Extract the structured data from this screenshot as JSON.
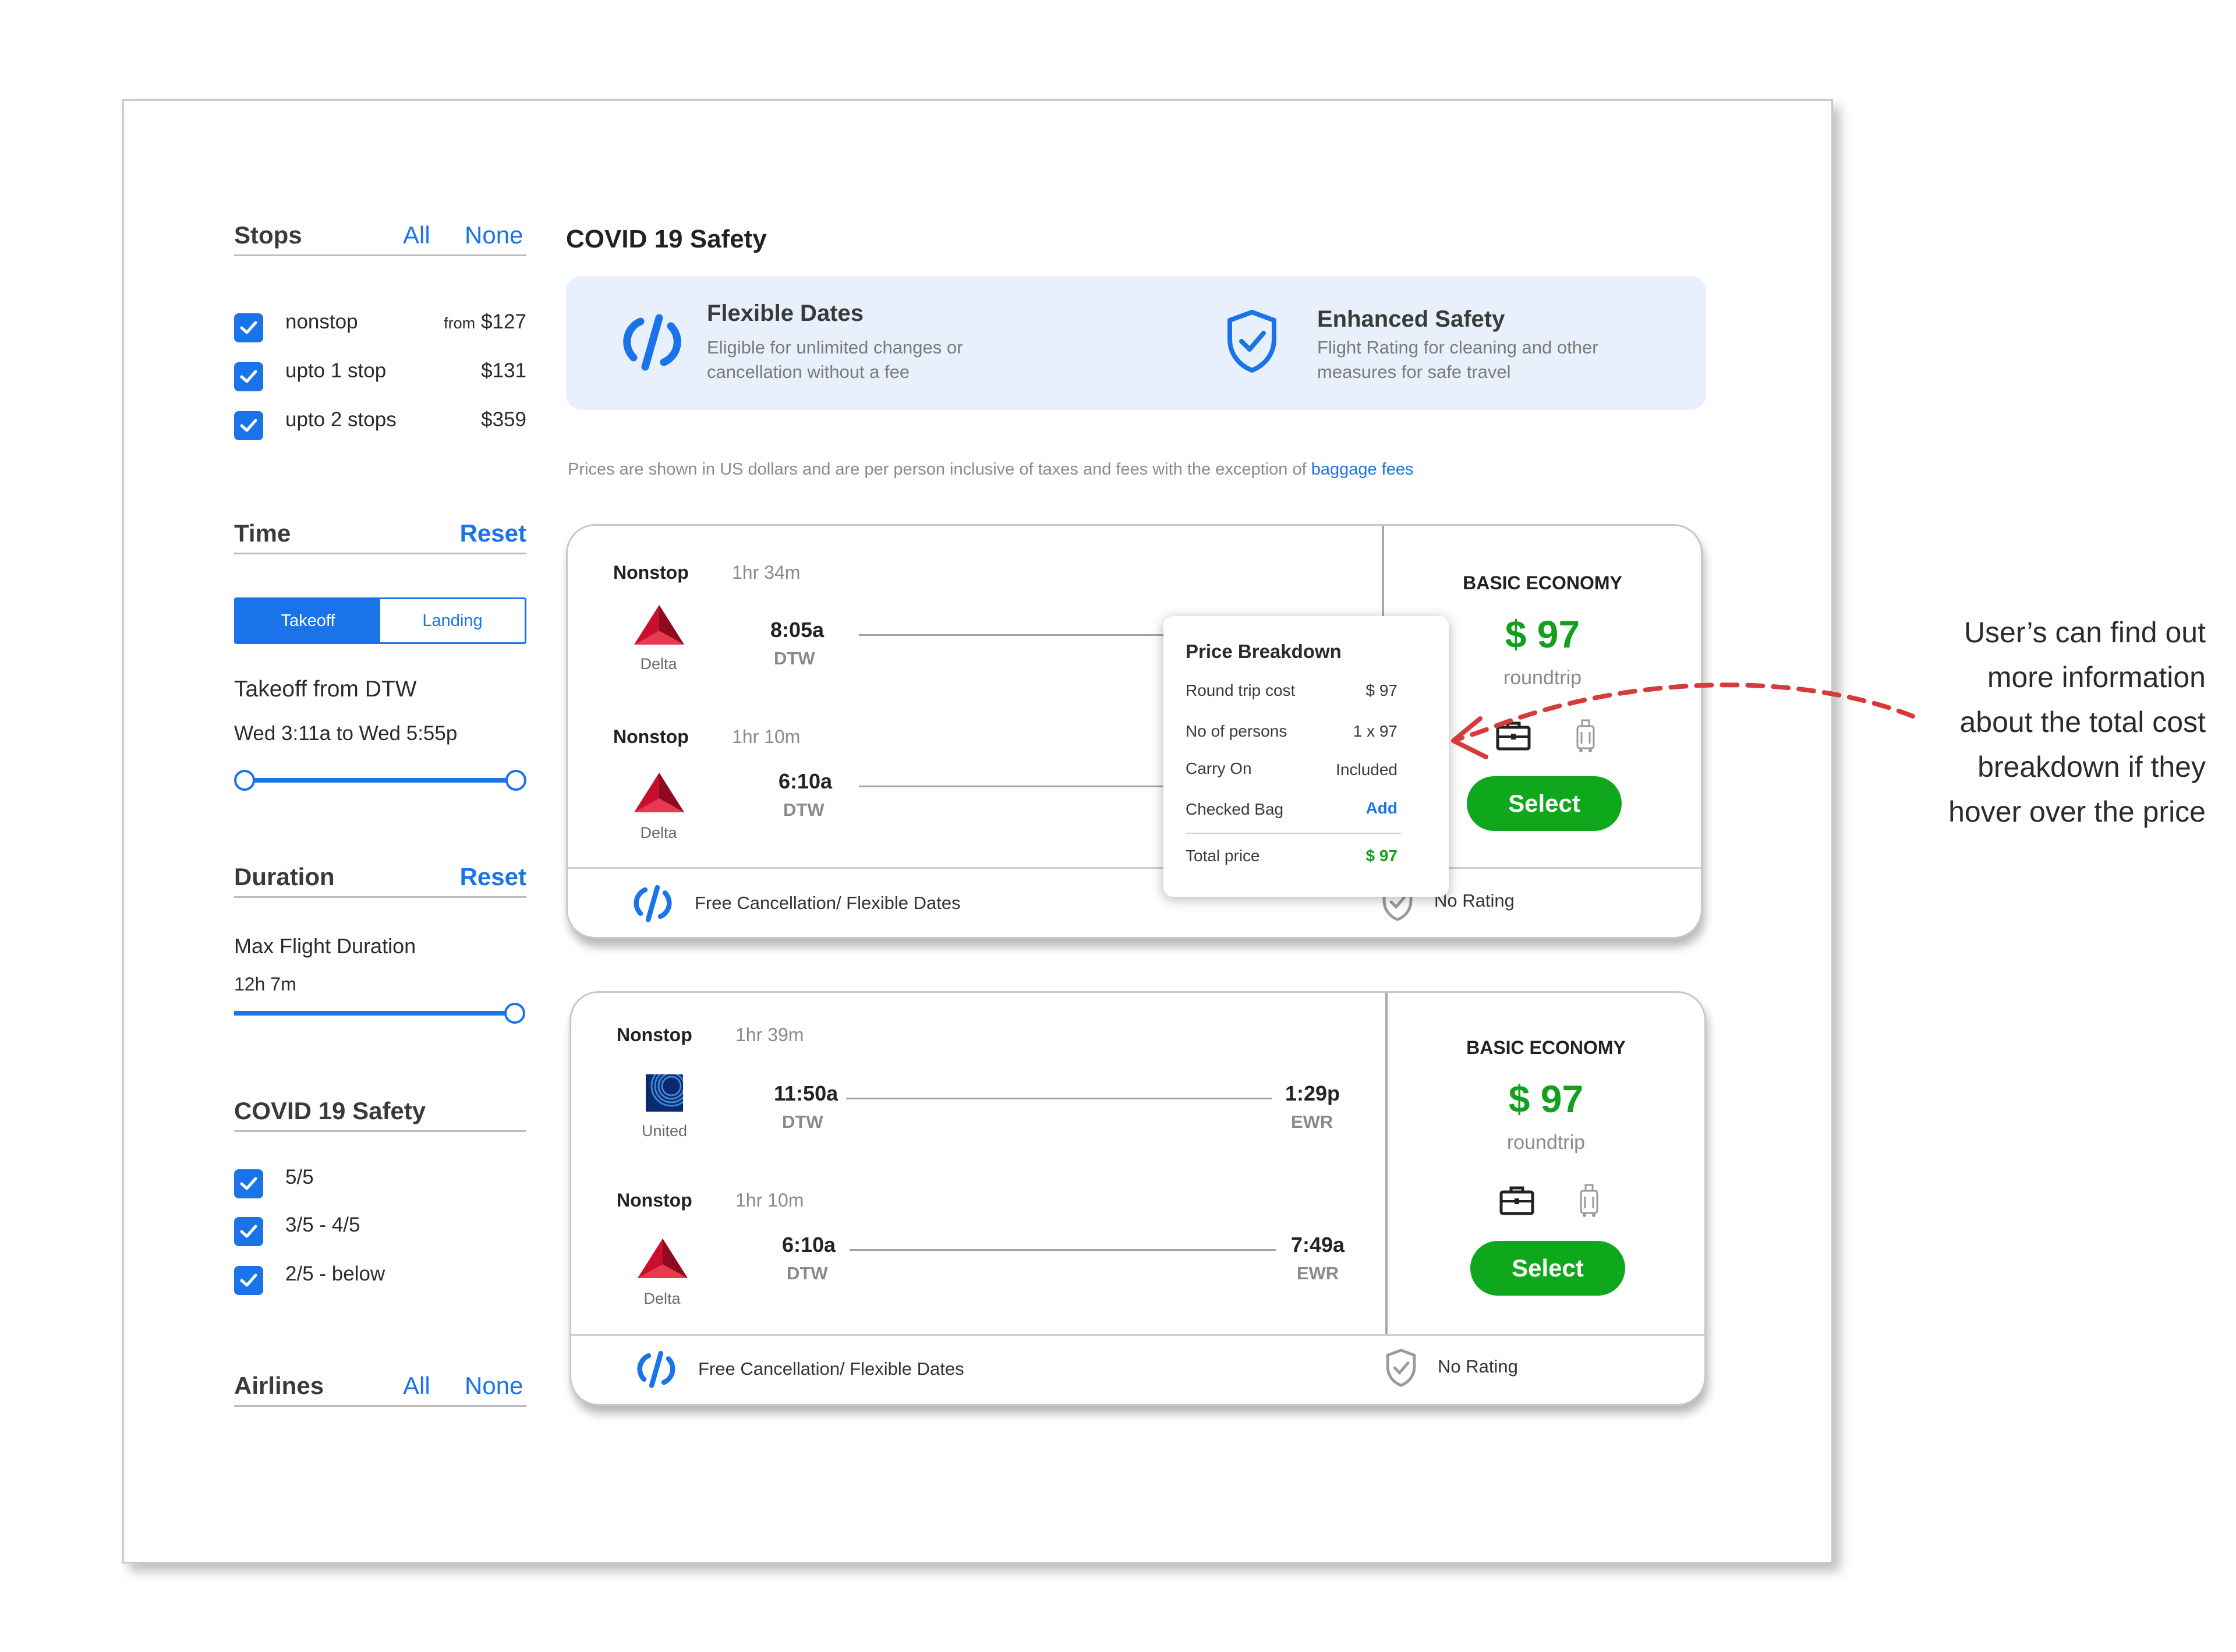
{
  "sidebar": {
    "stops": {
      "title": "Stops",
      "all": "All",
      "none": "None",
      "options": [
        {
          "label": "nonstop",
          "from": "from",
          "price": "$127",
          "checked": true
        },
        {
          "label": "upto 1 stop",
          "price": "$131",
          "checked": true
        },
        {
          "label": "upto 2 stops",
          "price": "$359",
          "checked": true
        }
      ]
    },
    "time": {
      "title": "Time",
      "reset": "Reset",
      "toggle": {
        "takeoff": "Takeoff",
        "landing": "Landing",
        "selected": "Takeoff"
      },
      "takeoff_from": "Takeoff from DTW",
      "range": "Wed 3:11a to Wed 5:55p"
    },
    "duration": {
      "title": "Duration",
      "reset": "Reset",
      "label": "Max Flight Duration",
      "value": "12h 7m"
    },
    "covid": {
      "title": "COVID 19 Safety",
      "options": [
        {
          "label": "5/5",
          "checked": true
        },
        {
          "label": "3/5 - 4/5",
          "checked": true
        },
        {
          "label": "2/5 - below",
          "checked": true
        }
      ]
    },
    "airlines": {
      "title": "Airlines",
      "all": "All",
      "none": "None"
    }
  },
  "main": {
    "title": "COVID 19  Safety",
    "banner": {
      "flexible": {
        "title": "Flexible Dates",
        "desc_1": "Eligible for unlimited changes or",
        "desc_2": "cancellation without a fee"
      },
      "safety": {
        "title": "Enhanced Safety",
        "desc_1": "Flight Rating for cleaning and other",
        "desc_2": "measures for safe travel"
      }
    },
    "note": "Prices are shown in US dollars and are per person inclusive of taxes and fees with the exception of",
    "note_link": "baggage fees"
  },
  "cards": [
    {
      "legs": [
        {
          "stop": "Nonstop",
          "duration": "1hr 34m",
          "airline": "Delta",
          "depart": "8:05a",
          "from": "DTW"
        },
        {
          "stop": "Nonstop",
          "duration": "1hr 10m",
          "airline": "Delta",
          "depart": "6:10a",
          "from": "DTW"
        }
      ],
      "fare": "BASIC ECONOMY",
      "price": "$ 97",
      "trip": "roundtrip",
      "select": "Select",
      "footer": {
        "flex": "Free Cancellation/ Flexible Dates",
        "rating": "No Rating"
      }
    },
    {
      "legs": [
        {
          "stop": "Nonstop",
          "duration": "1hr 39m",
          "airline": "United",
          "depart": "11:50a",
          "from": "DTW",
          "arrive": "1:29p",
          "to": "EWR"
        },
        {
          "stop": "Nonstop",
          "duration": "1hr 10m",
          "airline": "Delta",
          "depart": "6:10a",
          "from": "DTW",
          "arrive": "7:49a",
          "to": "EWR"
        }
      ],
      "fare": "BASIC ECONOMY",
      "price": "$ 97",
      "trip": "roundtrip",
      "select": "Select",
      "footer": {
        "flex": "Free Cancellation/ Flexible Dates",
        "rating": "No Rating"
      }
    }
  ],
  "popup": {
    "title": "Price Breakdown",
    "rows": [
      {
        "label": "Round trip cost",
        "value": "$ 97"
      },
      {
        "label": "No of persons",
        "value": "1 x 97"
      },
      {
        "label": "Carry On",
        "value": "Included"
      },
      {
        "label": "Checked Bag",
        "value": "Add"
      }
    ],
    "total_label": "Total price",
    "total_value": "$ 97"
  },
  "annotation": {
    "lines": [
      "User’s can find out",
      "more information",
      "about the total cost",
      "breakdown if they",
      "hover over the price"
    ]
  },
  "colors": {
    "accent": "#1a73e8",
    "price_green": "#14a01e",
    "select_green": "#0fa81c",
    "delta_red": "#c8102e",
    "annotation_red": "#d63a3a",
    "banner_bg": "#e7f0fb"
  },
  "icons": [
    "check-icon",
    "flexible-dates-icon",
    "shield-check-icon",
    "delta-logo-icon",
    "united-logo-icon",
    "briefcase-icon",
    "luggage-icon",
    "shield-outline-icon",
    "dashed-arrow-icon"
  ]
}
